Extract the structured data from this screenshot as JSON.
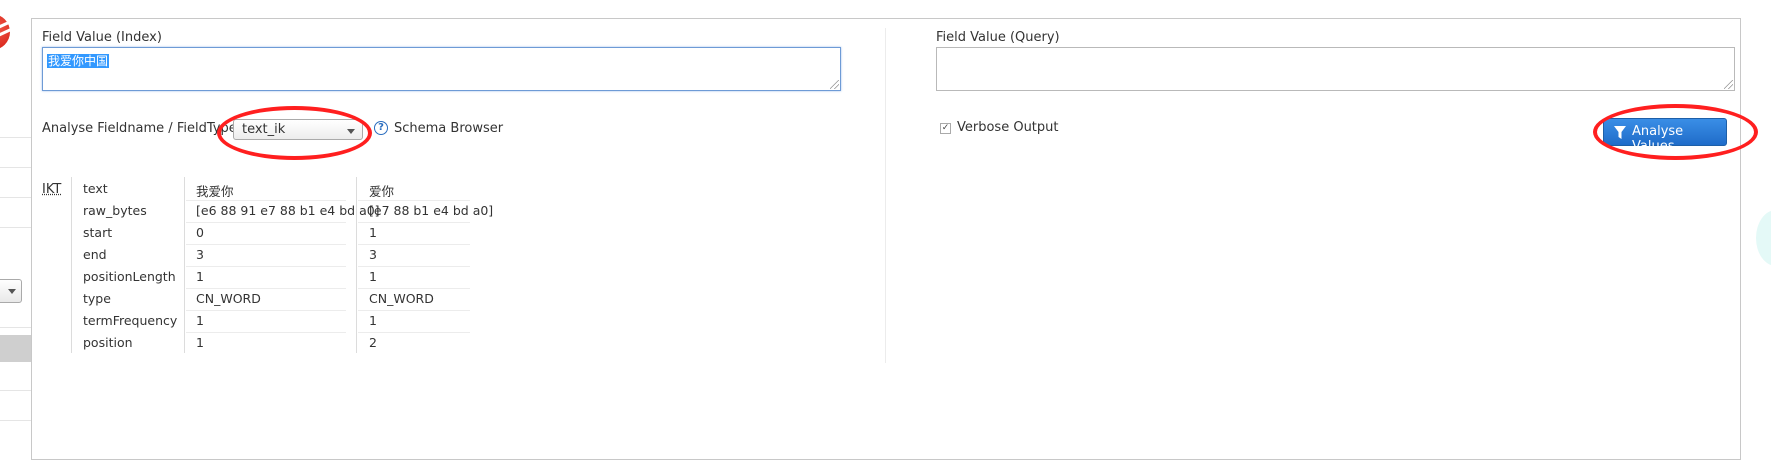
{
  "index": {
    "label": "Field Value (Index)",
    "value": "我爱你中国"
  },
  "query": {
    "label": "Field Value (Query)",
    "value": ""
  },
  "fieldtype": {
    "label": "Analyse Fieldname / FieldType:",
    "selected": "text_ik",
    "schema_browser": "Schema Browser"
  },
  "verbose": {
    "label": "Verbose Output",
    "checked": true
  },
  "analyse_button": "Analyse Values",
  "results": {
    "analyzer": "IKT",
    "attributes": [
      "text",
      "raw_bytes",
      "start",
      "end",
      "positionLength",
      "type",
      "termFrequency",
      "position"
    ],
    "tokens": [
      [
        "我爱你",
        "[e6 88 91 e7 88 b1 e4 bd a0]",
        "0",
        "3",
        "1",
        "CN_WORD",
        "1",
        "1"
      ],
      [
        "爱你",
        "[e7 88 b1 e4 bd a0]",
        "1",
        "3",
        "1",
        "CN_WORD",
        "1",
        "2"
      ]
    ]
  },
  "colors": {
    "accent": "#1f6cc9",
    "annotation": "#ff1f1f"
  }
}
